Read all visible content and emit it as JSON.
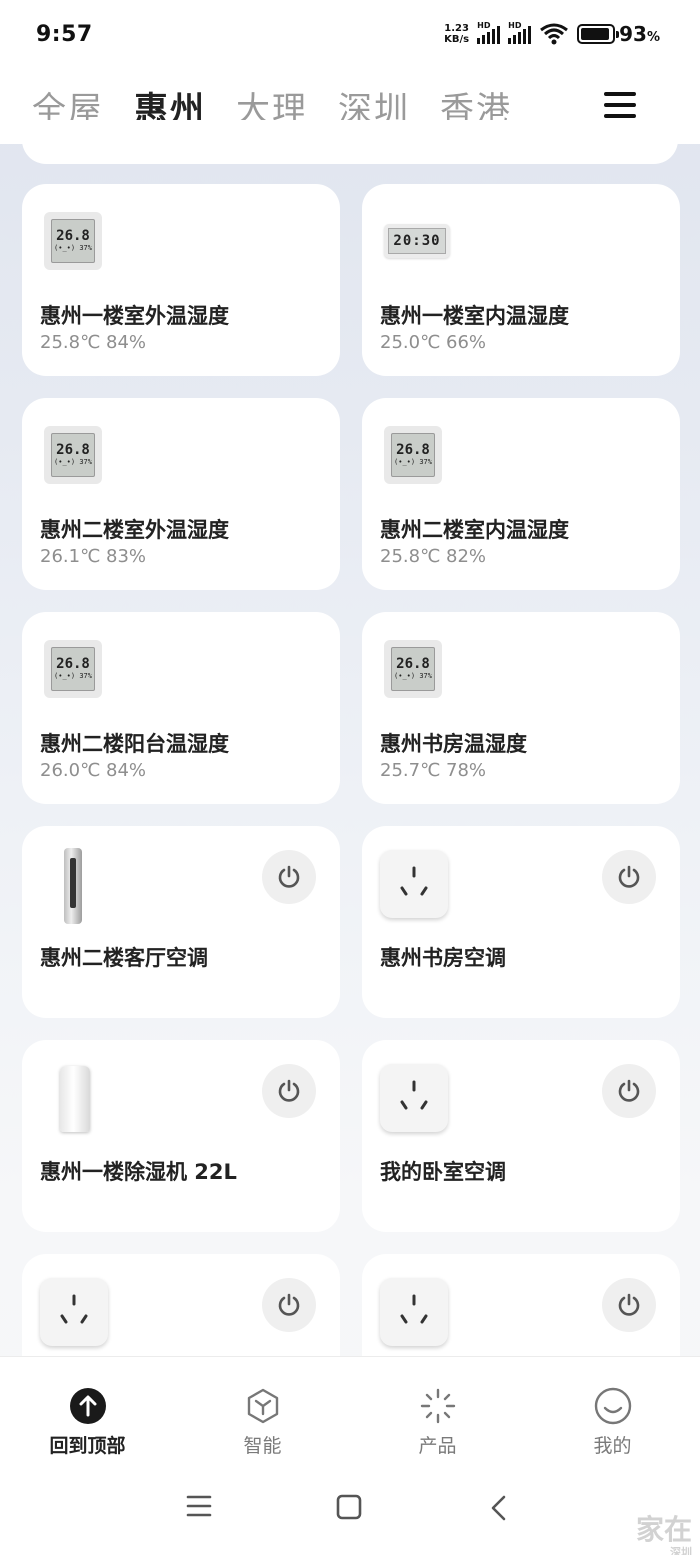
{
  "status_bar": {
    "time": "9:57",
    "net_speed_value": "1.23",
    "net_speed_unit": "KB/s",
    "hd_label": "HD",
    "battery_percent": "93",
    "battery_unit": "%"
  },
  "tabs": [
    {
      "label": "全屋",
      "active": false
    },
    {
      "label": "惠州",
      "active": true
    },
    {
      "label": "大理",
      "active": false
    },
    {
      "label": "深圳",
      "active": false
    },
    {
      "label": "香港",
      "active": false
    }
  ],
  "devices": [
    {
      "name": "惠州一楼室外温湿度",
      "status": "25.8℃ 84%",
      "icon": "thermometer-icon",
      "lcd_big": "26.8",
      "lcd_small": "(•_•) 37%"
    },
    {
      "name": "惠州一楼室内温湿度",
      "status": "25.0℃ 66%",
      "icon": "clock-thermometer-icon",
      "lcd_big": "20:30"
    },
    {
      "name": "惠州二楼室外温湿度",
      "status": "26.1℃ 83%",
      "icon": "thermometer-icon",
      "lcd_big": "26.8",
      "lcd_small": "(•_•) 37%"
    },
    {
      "name": "惠州二楼室内温湿度",
      "status": "25.8℃ 82%",
      "icon": "thermometer-icon",
      "lcd_big": "26.8",
      "lcd_small": "(•_•) 37%"
    },
    {
      "name": "惠州二楼阳台温湿度",
      "status": "26.0℃ 84%",
      "icon": "thermometer-icon",
      "lcd_big": "26.8",
      "lcd_small": "(•_•) 37%"
    },
    {
      "name": "惠州书房温湿度",
      "status": "25.7℃ 78%",
      "icon": "thermometer-icon",
      "lcd_big": "26.8",
      "lcd_small": "(•_•) 37%"
    },
    {
      "name": "惠州二楼客厅空调",
      "status": "",
      "icon": "tower-ac-icon"
    },
    {
      "name": "惠州书房空调",
      "status": "",
      "icon": "ac-socket-icon"
    },
    {
      "name": "惠州一楼除湿机 22L",
      "status": "",
      "icon": "dehumidifier-icon"
    },
    {
      "name": "我的卧室空调",
      "status": "",
      "icon": "ac-socket-icon"
    },
    {
      "name": "",
      "status": "",
      "icon": "ac-socket-icon"
    },
    {
      "name": "",
      "status": "",
      "icon": "ac-socket-icon"
    }
  ],
  "bottom_nav": [
    {
      "label": "回到顶部",
      "icon": "arrow-up-icon",
      "active": true
    },
    {
      "label": "智能",
      "icon": "hexagon-icon",
      "active": false
    },
    {
      "label": "产品",
      "icon": "sparkle-icon",
      "active": false
    },
    {
      "label": "我的",
      "icon": "smile-icon",
      "active": false
    }
  ],
  "watermark": {
    "text": "家在",
    "sub": "深圳"
  },
  "colors": {
    "accent": "#222222",
    "inactive": "#9a9a9a",
    "card": "#ffffff",
    "power_bg": "#efefef"
  }
}
